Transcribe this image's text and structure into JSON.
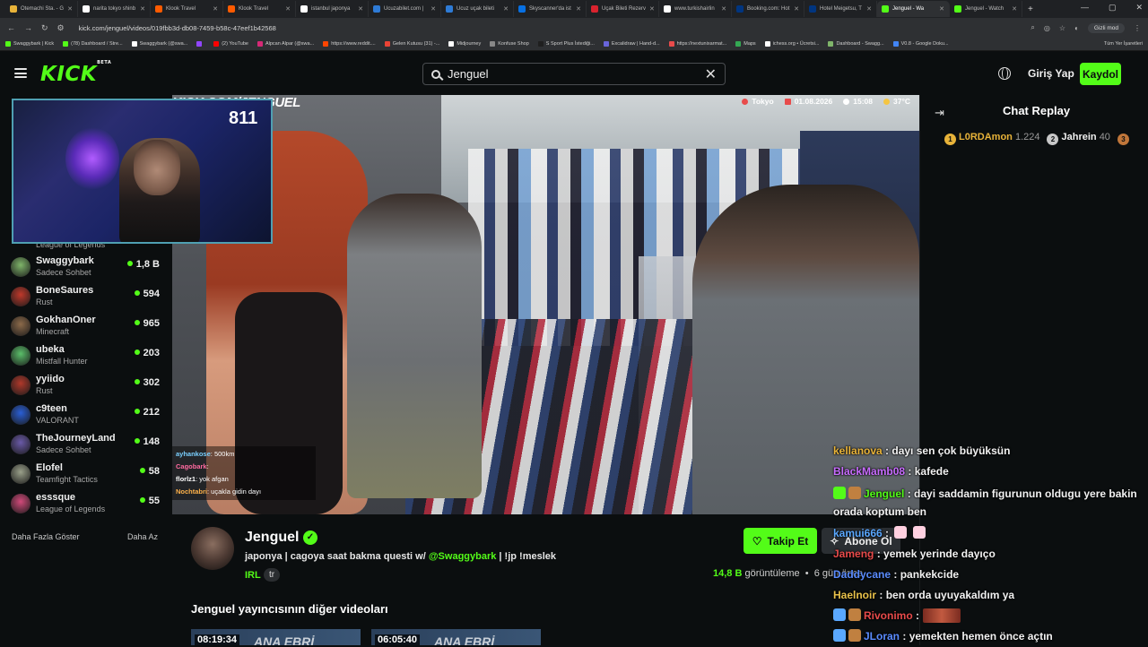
{
  "browser": {
    "tabs": [
      {
        "label": "Otemachi Sta. - G",
        "color": "#e8b339"
      },
      {
        "label": "narita tokyo shinb",
        "color": "#ffffff"
      },
      {
        "label": "Klook Travel",
        "color": "#ff5b00"
      },
      {
        "label": "Klook Travel",
        "color": "#ff5b00"
      },
      {
        "label": "istanbul japonya",
        "color": "#ffffff"
      },
      {
        "label": "Ucuzabilet.com |",
        "color": "#2e7bd6"
      },
      {
        "label": "Ucuz uçak bileti",
        "color": "#2e7bd6"
      },
      {
        "label": "Skyscanner'da ist",
        "color": "#0770e3"
      },
      {
        "label": "Uçak Bileti Rezerv",
        "color": "#d9232e"
      },
      {
        "label": "www.turkishairlin",
        "color": "#ffffff"
      },
      {
        "label": "Booking.com: Hot",
        "color": "#003580"
      },
      {
        "label": "Hotel Meigetsu, T",
        "color": "#003580"
      },
      {
        "label": "Jenguel - Wa",
        "color": "#53fc18",
        "active": true
      },
      {
        "label": "Jenguel - Watch",
        "color": "#53fc18"
      }
    ],
    "url": "kick.com/jenguel/videos/019fbb3d-db08-7459-b58c-47eef1b42568",
    "incognito_label": "Gizli mod",
    "bookmarks": [
      "Swaggybark | Kick",
      "(78) Dashboard / Stre...",
      "Swaggybark (@swa...",
      "",
      "(2) YouTube",
      "Alpcan Alpar (@swa...",
      "https://www.reddit....",
      "Gelen Kutusu (31) -...",
      "Midjourney",
      "Konfuse Shop",
      "S Sport Plus İstediği...",
      "Excalidraw | Hand-d...",
      "https://nextunixarmat...",
      "Maps",
      "ichess.org • Ücretsi...",
      "Dashboard - Swagg...",
      "V0.8 - Google Doku..."
    ],
    "bookmarks_all": "Tüm Yer İşaretleri"
  },
  "header": {
    "logo": "KICK",
    "logo_beta": "BETA",
    "search_value": "Jenguel",
    "login_label": "Giriş Yap",
    "signup_label": "Kaydol"
  },
  "sidebar": {
    "top_category": "League of Legends",
    "items": [
      {
        "name": "Swaggybark",
        "category": "Sadece Sohbet",
        "count": "1,8 B",
        "color": "#7fb56a"
      },
      {
        "name": "BoneSaures",
        "category": "Rust",
        "count": "594",
        "color": "#c0392b"
      },
      {
        "name": "GokhanOner",
        "category": "Minecraft",
        "count": "965",
        "color": "#8c6a4a"
      },
      {
        "name": "ubeka",
        "category": "Mistfall Hunter",
        "count": "203",
        "color": "#5bbf6a"
      },
      {
        "name": "yyiido",
        "category": "Rust",
        "count": "302",
        "color": "#b0392b"
      },
      {
        "name": "c9teen",
        "category": "VALORANT",
        "count": "212",
        "color": "#2a5fd6"
      },
      {
        "name": "TheJourneyLand",
        "category": "Sadece Sohbet",
        "count": "148",
        "color": "#6a5aa8"
      },
      {
        "name": "Elofel",
        "category": "Teamfight Tactics",
        "count": "58",
        "color": "#9aa08a"
      },
      {
        "name": "esssque",
        "category": "League of Legends",
        "count": "55",
        "color": "#d14a7a"
      }
    ],
    "show_more": "Daha Fazla Göster",
    "show_less": "Daha Az"
  },
  "webcam": {
    "viewer_count": "811"
  },
  "video": {
    "watermark": "KICK.COM/JENGUEL",
    "hud": {
      "location": "Tokyo",
      "date": "01.08.2026",
      "time": "15:08",
      "temp": "37°C"
    },
    "overlay_chat": [
      {
        "user": "ayhankose",
        "text": ": 500km",
        "color": "#7ad0ff"
      },
      {
        "user": "Cagobark",
        "text": ":",
        "color": "#ff6aa0"
      },
      {
        "user": "florlz1",
        "text": ": yok afgan",
        "color": "#ffffff"
      },
      {
        "user": "Nochtabri",
        "text": ": uçakla gidin dayı",
        "color": "#ffb24a"
      }
    ]
  },
  "stream": {
    "streamer_name": "Jenguel",
    "title_prefix": "japonya | cagoya saat bakma questi w/ ",
    "title_mention": "@Swaggybark",
    "title_suffix": " | !jp !meslek",
    "category": "IRL",
    "language": "tr",
    "follow_label": "Takip Et",
    "subscribe_label": "Abone Ol",
    "views": "14,8 B",
    "views_suffix": "görüntüleme",
    "age": "6 gün önce",
    "other_videos_title": "Jenguel yayıncısının diğer videoları",
    "thumbs": [
      {
        "duration": "08:19:34",
        "text": "ANA EBRİ"
      },
      {
        "duration": "06:05:40",
        "text": "ANA EBRİ"
      }
    ]
  },
  "chat": {
    "title": "Chat Replay",
    "leaderboard": [
      {
        "rank": "1",
        "name": "L0RDAmon",
        "points": "1.224",
        "color": "#e8b339",
        "name_color": "#e8b339"
      },
      {
        "rank": "2",
        "name": "Jahrein",
        "points": "40",
        "color": "#c8c8c8",
        "name_color": "#f0f0f0"
      },
      {
        "rank": "3",
        "name": "",
        "points": "",
        "color": "#c0763a",
        "name_color": "#f0f0f0"
      }
    ],
    "messages": [
      {
        "user": "kellanova",
        "text": ": dayı sen çok büyüksün",
        "color": "#e8b339"
      },
      {
        "user": "BlackMamb08",
        "text": ": kafede",
        "color": "#c86cff"
      },
      {
        "user": "Jenguel",
        "text": ": dayi saddamin figurunun oldugu yere bakin orada koptum ben",
        "color": "#53fc18",
        "wrap": true
      },
      {
        "user": "kamui666",
        "text": ":",
        "color": "#5aa8ff"
      },
      {
        "user": "Jameng",
        "text": ": yemek yerinde dayıço",
        "color": "#e84b4b"
      },
      {
        "user": "Daddycane",
        "text": ": pankekcide",
        "color": "#5a8cff"
      },
      {
        "user": "Haelnoir",
        "text": ": ben orda uyuyakaldım ya",
        "color": "#e8c14a"
      },
      {
        "user": "Rivonimo",
        "text": ":",
        "color": "#e84b4b"
      },
      {
        "user": "JLoran",
        "text": ": yemekten hemen önce açtın",
        "color": "#5a8cff"
      }
    ]
  }
}
